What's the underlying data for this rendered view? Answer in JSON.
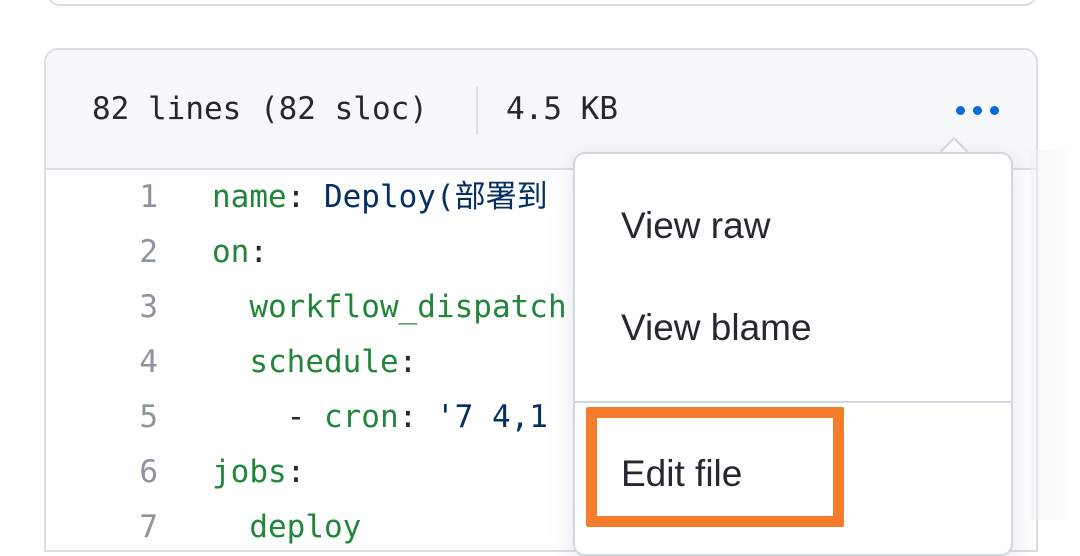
{
  "file_info": {
    "lines": "82 lines (82 sloc)",
    "size": "4.5 KB"
  },
  "code_lines": [
    {
      "num": "1",
      "parts": [
        [
          "k",
          "name"
        ],
        [
          "p",
          ": "
        ],
        [
          "s",
          "Deploy(部署到"
        ],
        [
          "s",
          "                   部署"
        ]
      ]
    },
    {
      "num": "2",
      "parts": [
        [
          "k",
          "on"
        ],
        [
          "p",
          ":"
        ]
      ]
    },
    {
      "num": "3",
      "parts": [
        [
          "p",
          "  "
        ],
        [
          "k",
          "workflow_dispatch"
        ]
      ]
    },
    {
      "num": "4",
      "parts": [
        [
          "p",
          "  "
        ],
        [
          "k",
          "schedule"
        ],
        [
          "p",
          ":"
        ]
      ]
    },
    {
      "num": "5",
      "parts": [
        [
          "p",
          "    - "
        ],
        [
          "k",
          "cron"
        ],
        [
          "p",
          ": "
        ],
        [
          "s",
          "'7 4,1"
        ]
      ]
    },
    {
      "num": "6",
      "parts": [
        [
          "k",
          "jobs"
        ],
        [
          "p",
          ":"
        ]
      ]
    },
    {
      "num": "7",
      "parts": [
        [
          "p",
          "  "
        ],
        [
          "k",
          "deploy"
        ]
      ]
    }
  ],
  "menu": {
    "view_raw": "View raw",
    "view_blame": "View blame",
    "edit_file": "Edit file"
  },
  "colors": {
    "accent_blue": "#0969da",
    "highlight_orange": "#f57c2a",
    "key_green": "#22863a",
    "string_navy": "#032f62"
  },
  "icons": {
    "more_options": "kebab-horizontal-icon"
  }
}
